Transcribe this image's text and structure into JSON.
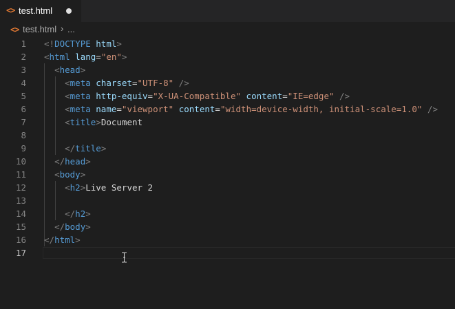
{
  "tab": {
    "icon": "html-angle-brackets-icon",
    "filename": "test.html",
    "dirty": true
  },
  "breadcrumb": {
    "icon": "html-angle-brackets-icon",
    "file": "test.html",
    "separator": "›",
    "more": "..."
  },
  "editor": {
    "active_line": 17,
    "lines": [
      {
        "n": "1",
        "tokens": [
          [
            "t-punct",
            "<!"
          ],
          [
            "t-tag",
            "DOCTYPE"
          ],
          [
            "t-text",
            " "
          ],
          [
            "t-attr",
            "html"
          ],
          [
            "t-punct",
            ">"
          ]
        ]
      },
      {
        "n": "2",
        "tokens": [
          [
            "t-punct",
            "<"
          ],
          [
            "t-tag",
            "html"
          ],
          [
            "t-text",
            " "
          ],
          [
            "t-attr",
            "lang"
          ],
          [
            "t-text",
            "="
          ],
          [
            "t-str",
            "\"en\""
          ],
          [
            "t-punct",
            ">"
          ]
        ]
      },
      {
        "n": "3",
        "tokens": [
          [
            "t-text",
            "  "
          ],
          [
            "t-punct",
            "<"
          ],
          [
            "t-tag",
            "head"
          ],
          [
            "t-punct",
            ">"
          ]
        ]
      },
      {
        "n": "4",
        "tokens": [
          [
            "t-text",
            "    "
          ],
          [
            "t-punct",
            "<"
          ],
          [
            "t-tag",
            "meta"
          ],
          [
            "t-text",
            " "
          ],
          [
            "t-attr",
            "charset"
          ],
          [
            "t-text",
            "="
          ],
          [
            "t-str",
            "\"UTF-8\""
          ],
          [
            "t-text",
            " "
          ],
          [
            "t-punct",
            "/>"
          ]
        ]
      },
      {
        "n": "5",
        "tokens": [
          [
            "t-text",
            "    "
          ],
          [
            "t-punct",
            "<"
          ],
          [
            "t-tag",
            "meta"
          ],
          [
            "t-text",
            " "
          ],
          [
            "t-attr",
            "http-equiv"
          ],
          [
            "t-text",
            "="
          ],
          [
            "t-str",
            "\"X-UA-Compatible\""
          ],
          [
            "t-text",
            " "
          ],
          [
            "t-attr",
            "content"
          ],
          [
            "t-text",
            "="
          ],
          [
            "t-str",
            "\"IE=edge\""
          ],
          [
            "t-text",
            " "
          ],
          [
            "t-punct",
            "/>"
          ]
        ]
      },
      {
        "n": "6",
        "tokens": [
          [
            "t-text",
            "    "
          ],
          [
            "t-punct",
            "<"
          ],
          [
            "t-tag",
            "meta"
          ],
          [
            "t-text",
            " "
          ],
          [
            "t-attr",
            "name"
          ],
          [
            "t-text",
            "="
          ],
          [
            "t-str",
            "\"viewport\""
          ],
          [
            "t-text",
            " "
          ],
          [
            "t-attr",
            "content"
          ],
          [
            "t-text",
            "="
          ],
          [
            "t-str",
            "\"width=device-width, initial-scale=1.0\""
          ],
          [
            "t-text",
            " "
          ],
          [
            "t-punct",
            "/>"
          ]
        ]
      },
      {
        "n": "7",
        "tokens": [
          [
            "t-text",
            "    "
          ],
          [
            "t-punct",
            "<"
          ],
          [
            "t-tag",
            "title"
          ],
          [
            "t-punct",
            ">"
          ],
          [
            "t-text",
            "Document"
          ]
        ]
      },
      {
        "n": "8",
        "tokens": []
      },
      {
        "n": "9",
        "tokens": [
          [
            "t-text",
            "    "
          ],
          [
            "t-punct",
            "</"
          ],
          [
            "t-tag",
            "title"
          ],
          [
            "t-punct",
            ">"
          ]
        ]
      },
      {
        "n": "10",
        "tokens": [
          [
            "t-text",
            "  "
          ],
          [
            "t-punct",
            "</"
          ],
          [
            "t-tag",
            "head"
          ],
          [
            "t-punct",
            ">"
          ]
        ]
      },
      {
        "n": "11",
        "tokens": [
          [
            "t-text",
            "  "
          ],
          [
            "t-punct",
            "<"
          ],
          [
            "t-tag",
            "body"
          ],
          [
            "t-punct",
            ">"
          ]
        ]
      },
      {
        "n": "12",
        "tokens": [
          [
            "t-text",
            "    "
          ],
          [
            "t-punct",
            "<"
          ],
          [
            "t-tag",
            "h2"
          ],
          [
            "t-punct",
            ">"
          ],
          [
            "t-text",
            "Live Server 2"
          ]
        ]
      },
      {
        "n": "13",
        "tokens": []
      },
      {
        "n": "14",
        "tokens": [
          [
            "t-text",
            "    "
          ],
          [
            "t-punct",
            "</"
          ],
          [
            "t-tag",
            "h2"
          ],
          [
            "t-punct",
            ">"
          ]
        ]
      },
      {
        "n": "15",
        "tokens": [
          [
            "t-text",
            "  "
          ],
          [
            "t-punct",
            "</"
          ],
          [
            "t-tag",
            "body"
          ],
          [
            "t-punct",
            ">"
          ]
        ]
      },
      {
        "n": "16",
        "tokens": [
          [
            "t-punct",
            "</"
          ],
          [
            "t-tag",
            "html"
          ],
          [
            "t-punct",
            ">"
          ]
        ]
      },
      {
        "n": "17",
        "tokens": []
      }
    ]
  },
  "colors": {
    "background": "#1e1e1e",
    "tag": "#569cd6",
    "attribute": "#9cdcfe",
    "string": "#ce9178",
    "punctuation": "#808080",
    "text": "#d4d4d4",
    "html_icon": "#e37933"
  },
  "mouse_cursor": "text-ibeam-cursor-icon"
}
